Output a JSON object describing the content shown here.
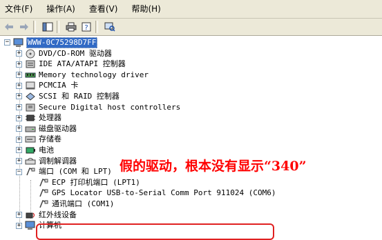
{
  "menu": [
    {
      "label": "文件(F)"
    },
    {
      "label": "操作(A)"
    },
    {
      "label": "查看(V)"
    },
    {
      "label": "帮助(H)"
    }
  ],
  "toolbar": {
    "buttons": [
      "back-arrow-icon",
      "forward-arrow-icon",
      "show-hide-tree-icon",
      "print-icon",
      "help-icon",
      "scan-hardware-icon"
    ]
  },
  "tree": {
    "root": "WWW-0C75298D7FF",
    "items": [
      {
        "label": "DVD/CD-ROM 驱动器",
        "icon": "cdrom-icon"
      },
      {
        "label": "IDE ATA/ATAPI 控制器",
        "icon": "ide-controller-icon"
      },
      {
        "label": "Memory technology driver",
        "icon": "memory-icon"
      },
      {
        "label": "PCMCIA 卡",
        "icon": "pcmcia-icon"
      },
      {
        "label": "SCSI 和 RAID 控制器",
        "icon": "scsi-icon"
      },
      {
        "label": "Secure Digital host controllers",
        "icon": "sd-controller-icon"
      },
      {
        "label": "处理器",
        "icon": "processor-icon"
      },
      {
        "label": "磁盘驱动器",
        "icon": "disk-drive-icon"
      },
      {
        "label": "存储卷",
        "icon": "storage-volume-icon"
      },
      {
        "label": "电池",
        "icon": "battery-icon"
      },
      {
        "label": "调制解调器",
        "icon": "modem-icon"
      },
      {
        "label": "端口 (COM 和 LPT)",
        "icon": "port-icon",
        "expanded": true
      }
    ],
    "port_children": [
      {
        "label": "ECP 打印机端口 (LPT1)",
        "icon": "printer-port-icon"
      },
      {
        "label": "GPS Locator USB-to-Serial Comm Port 911024 (COM6)",
        "icon": "serial-port-icon"
      },
      {
        "label": "通讯端口 (COM1)",
        "icon": "comm-port-icon"
      }
    ],
    "after": [
      {
        "label": "红外线设备",
        "icon": "infrared-icon"
      },
      {
        "label": "计算机",
        "icon": "computer-icon"
      }
    ]
  },
  "annotation": {
    "text": "假的驱动，根本没有显示“340”"
  },
  "colors": {
    "annotation": "#ff0000",
    "selection": "#316ac5",
    "highlight_box": "#e02020",
    "chrome": "#ece9d8"
  }
}
